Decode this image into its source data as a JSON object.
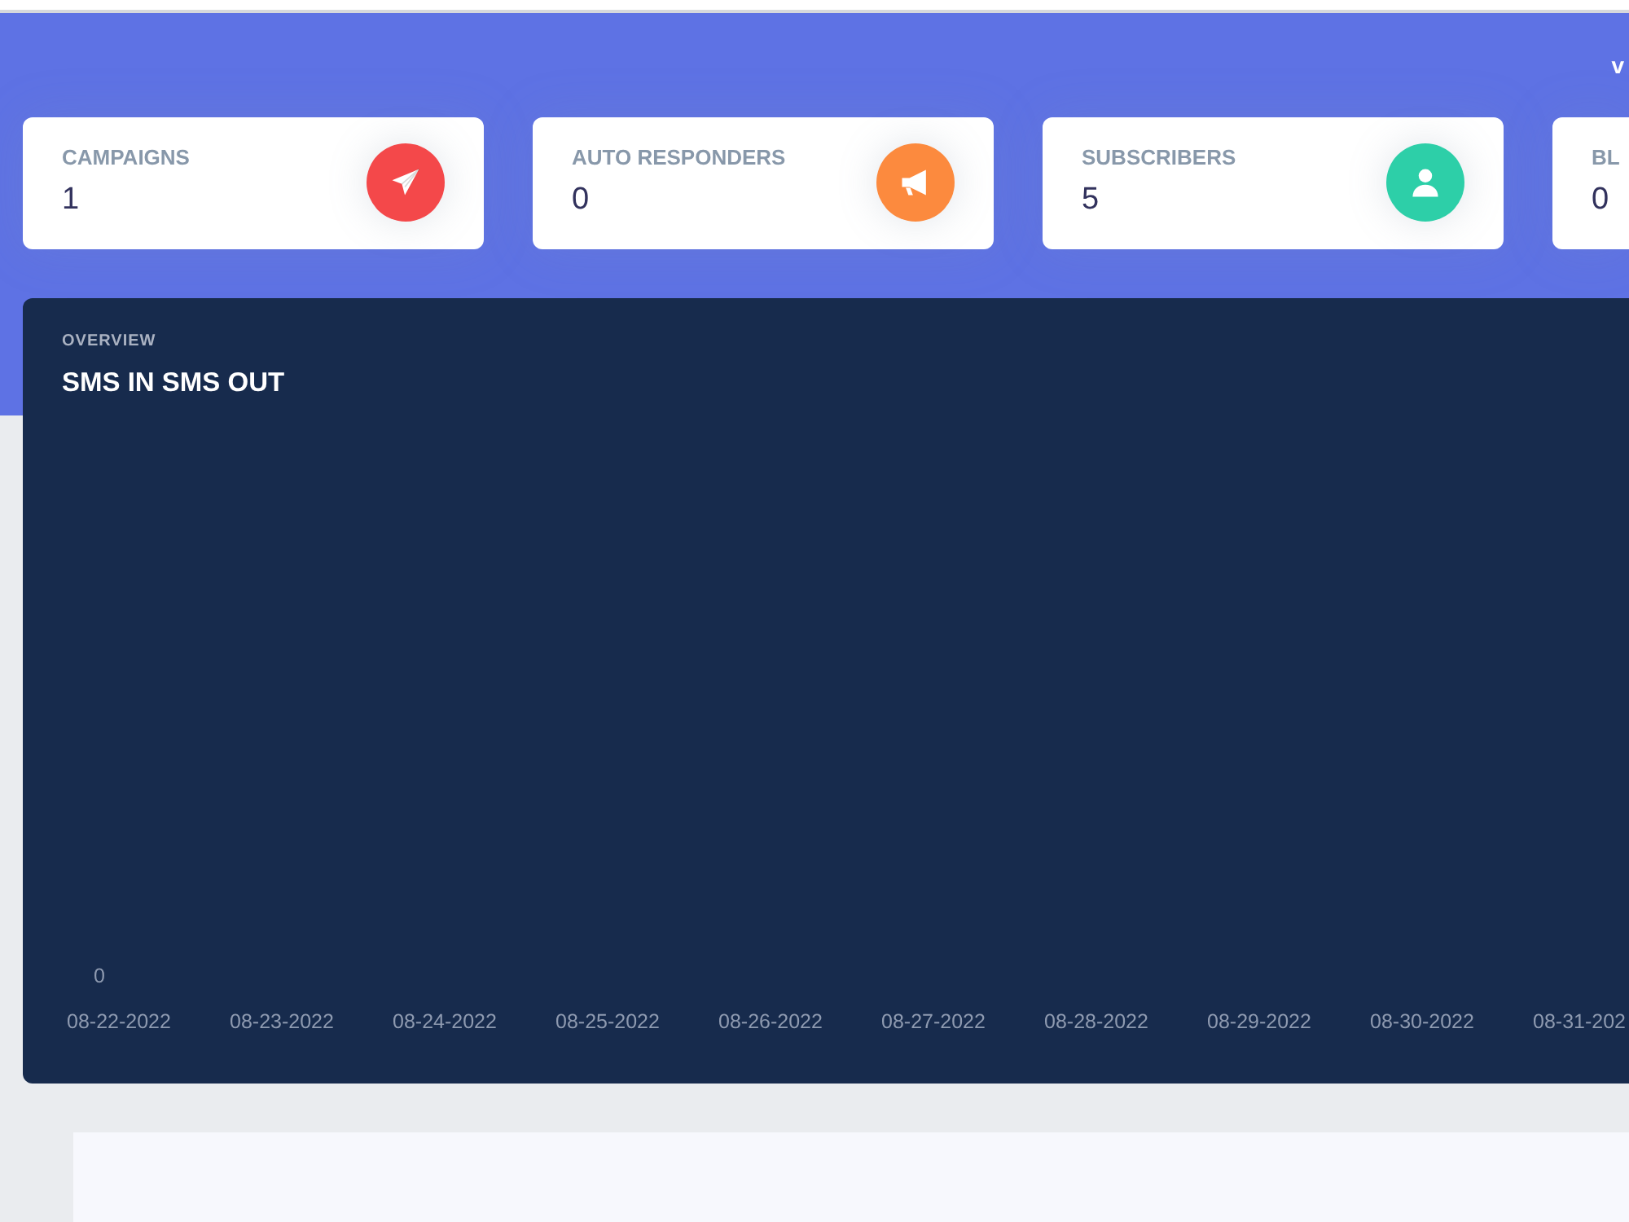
{
  "header": {
    "text": "v"
  },
  "stats": [
    {
      "label": "CAMPAIGNS",
      "value": "1",
      "color": "#f4484a"
    },
    {
      "label": "AUTO RESPONDERS",
      "value": "0",
      "color": "#fc8a3e"
    },
    {
      "label": "SUBSCRIBERS",
      "value": "5",
      "color": "#2dcfa8"
    },
    {
      "label": "BL",
      "value": "0"
    }
  ],
  "overview": {
    "overline": "OVERVIEW",
    "title": "SMS IN SMS OUT",
    "y_axis_labels": [
      "0"
    ],
    "x_axis_labels": [
      "08-22-2022",
      "08-23-2022",
      "08-24-2022",
      "08-25-2022",
      "08-26-2022",
      "08-27-2022",
      "08-28-2022",
      "08-29-2022",
      "08-30-2022",
      "08-31-202"
    ]
  }
}
